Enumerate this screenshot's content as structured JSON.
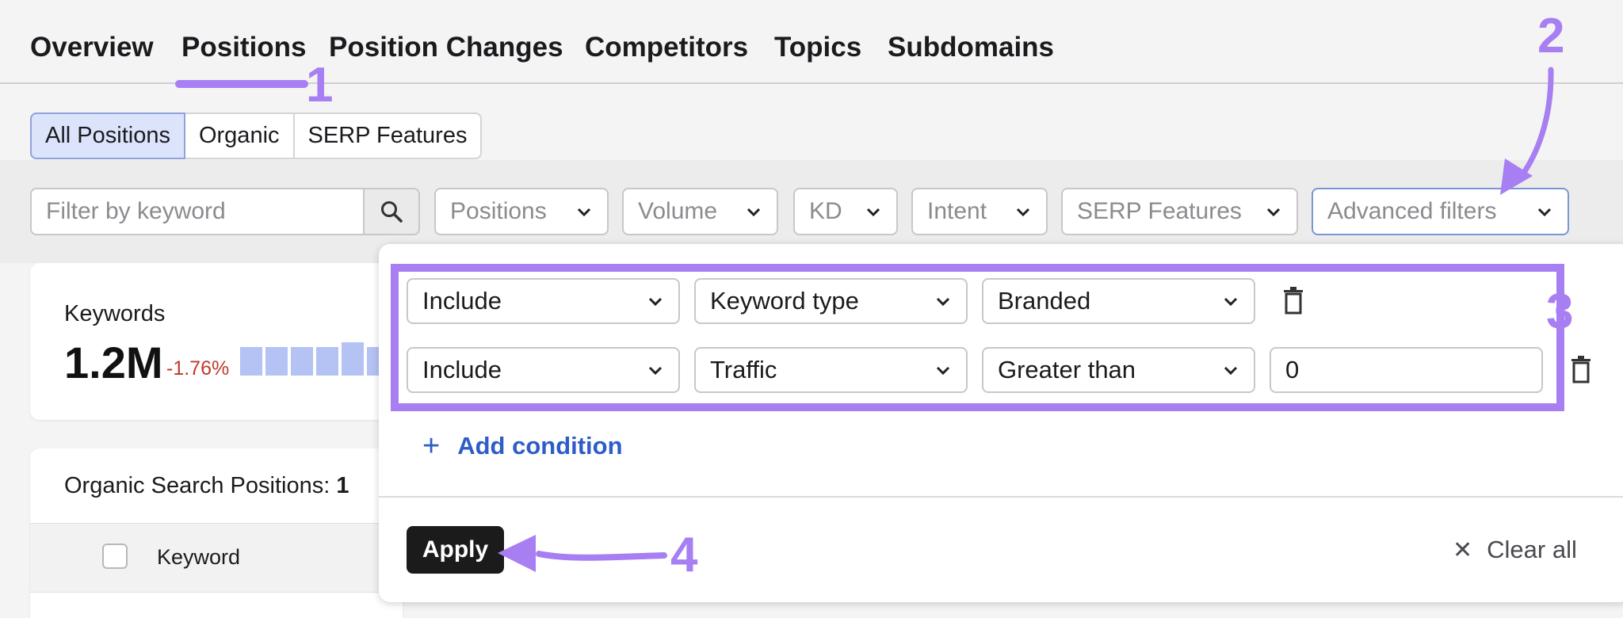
{
  "nav": {
    "tabs": [
      "Overview",
      "Positions",
      "Position Changes",
      "Competitors",
      "Topics",
      "Subdomains"
    ],
    "active": "Positions"
  },
  "segments": [
    "All Positions",
    "Organic",
    "SERP Features"
  ],
  "filters": {
    "search_placeholder": "Filter by keyword",
    "dropdowns": [
      "Positions",
      "Volume",
      "KD",
      "Intent",
      "SERP Features",
      "Advanced filters"
    ]
  },
  "summary": {
    "label": "Keywords",
    "value": "1.2M",
    "change": "-1.76%",
    "mini_bars_fill": [
      0.78,
      0.78,
      0.78,
      0.78,
      0.92,
      0.78
    ]
  },
  "table": {
    "title": "Organic Search Positions:",
    "title_count": "1",
    "column_keyword": "Keyword"
  },
  "advanced_filters": {
    "conditions": [
      {
        "mode": "Include",
        "field": "Keyword type",
        "operator": "Branded"
      },
      {
        "mode": "Include",
        "field": "Traffic",
        "operator": "Greater than",
        "value": "0"
      }
    ],
    "add_condition": "Add condition",
    "apply": "Apply",
    "clear_all": "Clear all"
  },
  "annotations": [
    "1",
    "2",
    "3",
    "4"
  ],
  "colors": {
    "annotation": "#a77ff2",
    "link": "#2e5cc8",
    "negative": "#c0392b",
    "active_segment": "#dbe4fb"
  }
}
